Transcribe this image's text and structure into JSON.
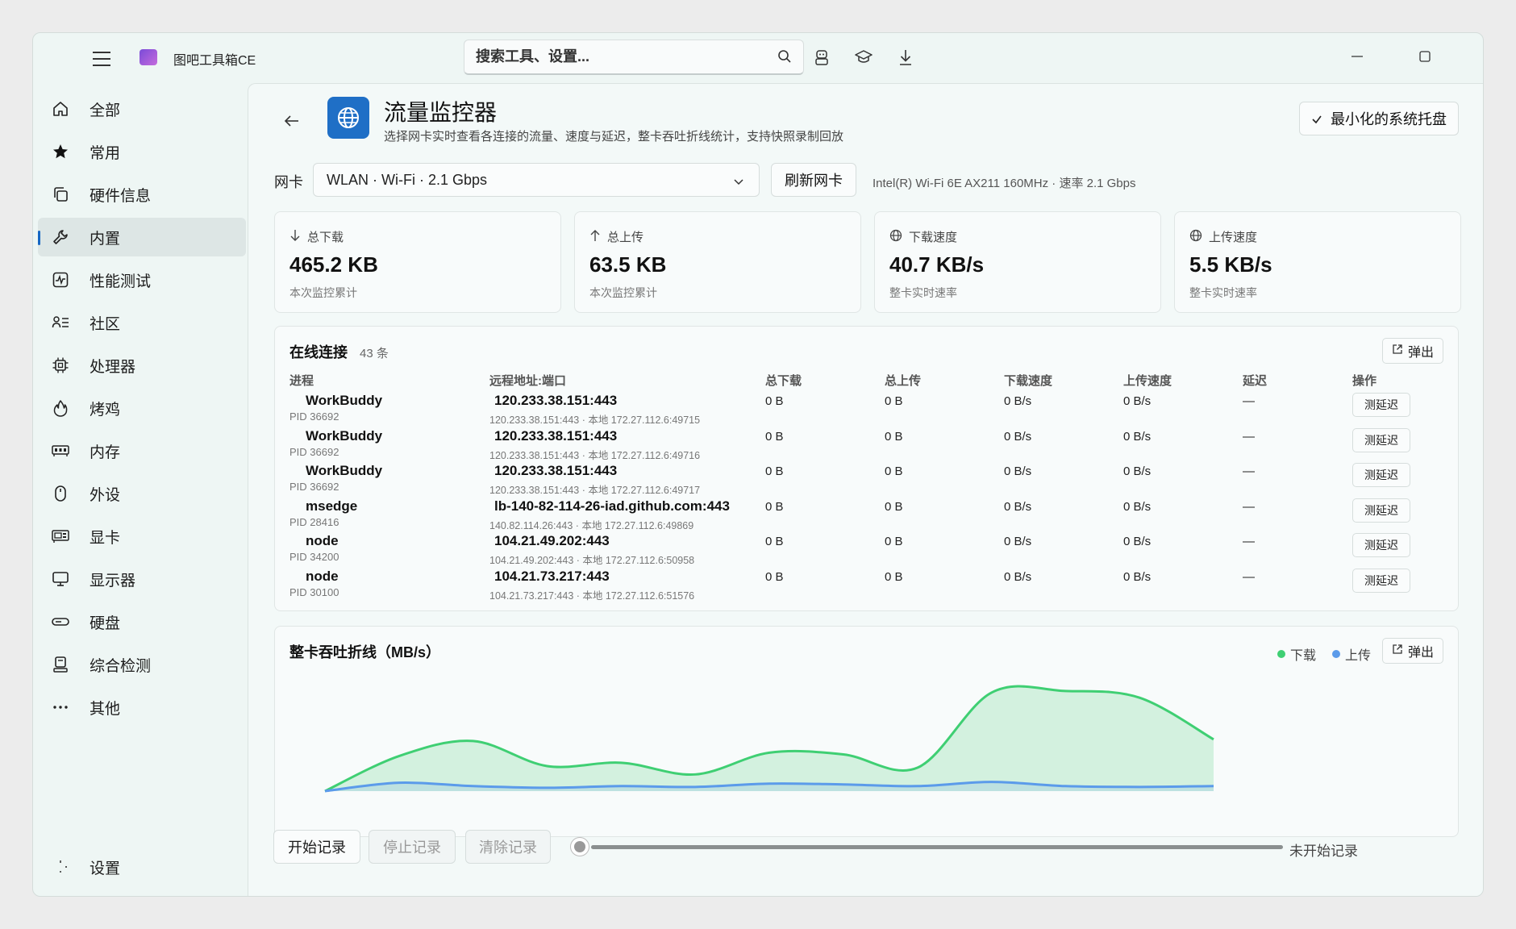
{
  "app": {
    "title": "图吧工具箱CE"
  },
  "search": {
    "placeholder": "搜索工具、设置..."
  },
  "sidebar": {
    "items": [
      {
        "label": "全部",
        "icon": "home-icon"
      },
      {
        "label": "常用",
        "icon": "star-icon"
      },
      {
        "label": "硬件信息",
        "icon": "copy-icon"
      },
      {
        "label": "内置",
        "icon": "wrench-icon",
        "active": true
      },
      {
        "label": "性能测试",
        "icon": "pulse-icon"
      },
      {
        "label": "社区",
        "icon": "people-icon"
      },
      {
        "label": "处理器",
        "icon": "cpu-icon"
      },
      {
        "label": "烤鸡",
        "icon": "flame-icon"
      },
      {
        "label": "内存",
        "icon": "memory-icon"
      },
      {
        "label": "外设",
        "icon": "mouse-icon"
      },
      {
        "label": "显卡",
        "icon": "gpu-icon"
      },
      {
        "label": "显示器",
        "icon": "monitor-icon"
      },
      {
        "label": "硬盘",
        "icon": "disk-icon"
      },
      {
        "label": "综合检测",
        "icon": "server-icon"
      },
      {
        "label": "其他",
        "icon": "more-icon"
      }
    ],
    "settings_label": "设置"
  },
  "tool": {
    "title": "流量监控器",
    "description": "选择网卡实时查看各连接的流量、速度与延迟，整卡吞吐折线统计，支持快照录制回放",
    "tray_label": "最小化的系统托盘"
  },
  "nic": {
    "label": "网卡",
    "selected": "WLAN · Wi-Fi · 2.1 Gbps",
    "refresh_label": "刷新网卡",
    "info": "Intel(R) Wi-Fi 6E AX211 160MHz · 速率 2.1 Gbps"
  },
  "stats": [
    {
      "label": "总下载",
      "value": "465.2 KB",
      "sub": "本次监控累计",
      "icon": "arrow-down-icon"
    },
    {
      "label": "总上传",
      "value": "63.5 KB",
      "sub": "本次监控累计",
      "icon": "arrow-up-icon"
    },
    {
      "label": "下载速度",
      "value": "40.7 KB/s",
      "sub": "整卡实时速率",
      "icon": "globe-icon"
    },
    {
      "label": "上传速度",
      "value": "5.5 KB/s",
      "sub": "整卡实时速率",
      "icon": "globe-icon"
    }
  ],
  "connections": {
    "title": "在线连接",
    "count": "43 条",
    "popout_label": "弹出",
    "headers": [
      "进程",
      "远程地址:端口",
      "总下载",
      "总上传",
      "下载速度",
      "上传速度",
      "延迟",
      "操作"
    ],
    "ping_label": "测延迟",
    "rows": [
      {
        "process": "WorkBuddy",
        "pid": "PID 36692",
        "remote": "120.233.38.151:443",
        "detail": "120.233.38.151:443 · 本地 172.27.112.6:49715",
        "down": "0 B",
        "up": "0 B",
        "down_speed": "0 B/s",
        "up_speed": "0 B/s",
        "latency": "—"
      },
      {
        "process": "WorkBuddy",
        "pid": "PID 36692",
        "remote": "120.233.38.151:443",
        "detail": "120.233.38.151:443 · 本地 172.27.112.6:49716",
        "down": "0 B",
        "up": "0 B",
        "down_speed": "0 B/s",
        "up_speed": "0 B/s",
        "latency": "—"
      },
      {
        "process": "WorkBuddy",
        "pid": "PID 36692",
        "remote": "120.233.38.151:443",
        "detail": "120.233.38.151:443 · 本地 172.27.112.6:49717",
        "down": "0 B",
        "up": "0 B",
        "down_speed": "0 B/s",
        "up_speed": "0 B/s",
        "latency": "—"
      },
      {
        "process": "msedge",
        "pid": "PID 28416",
        "remote": "lb-140-82-114-26-iad.github.com:443",
        "detail": "140.82.114.26:443 · 本地 172.27.112.6:49869",
        "down": "0 B",
        "up": "0 B",
        "down_speed": "0 B/s",
        "up_speed": "0 B/s",
        "latency": "—"
      },
      {
        "process": "node",
        "pid": "PID 34200",
        "remote": "104.21.49.202:443",
        "detail": "104.21.49.202:443 · 本地 172.27.112.6:50958",
        "down": "0 B",
        "up": "0 B",
        "down_speed": "0 B/s",
        "up_speed": "0 B/s",
        "latency": "—"
      },
      {
        "process": "node",
        "pid": "PID 30100",
        "remote": "104.21.73.217:443",
        "detail": "104.21.73.217:443 · 本地 172.27.112.6:51576",
        "down": "0 B",
        "up": "0 B",
        "down_speed": "0 B/s",
        "up_speed": "0 B/s",
        "latency": "—"
      }
    ]
  },
  "throughput": {
    "title": "整卡吞吐折线（MB/s）",
    "legend_download": "下载",
    "legend_upload": "上传",
    "popout_label": "弹出",
    "colors": {
      "download": "#3fcf73",
      "upload": "#5b9bea"
    },
    "download": [
      0,
      0.42,
      0.6,
      0.3,
      0.34,
      0.2,
      0.46,
      0.44,
      0.28,
      1.18,
      1.2,
      1.12,
      0.62
    ],
    "upload": [
      0,
      0.1,
      0.06,
      0.04,
      0.06,
      0.05,
      0.09,
      0.08,
      0.06,
      0.11,
      0.06,
      0.05,
      0.06
    ],
    "ymax": 1.45
  },
  "recording": {
    "start_label": "开始记录",
    "stop_label": "停止记录",
    "clear_label": "清除记录",
    "status": "未开始记录",
    "progress": 0
  }
}
